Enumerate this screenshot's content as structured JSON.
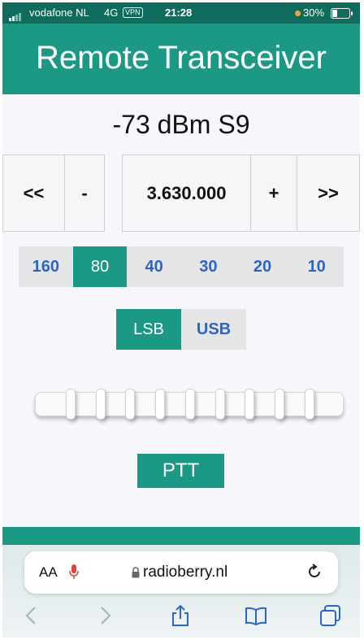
{
  "status_bar": {
    "carrier": "vodafone NL",
    "network": "4G",
    "vpn": "VPN",
    "time": "21:28",
    "battery": "30%"
  },
  "header": {
    "title": "Remote Transceiver"
  },
  "signal": {
    "reading": "-73 dBm S9"
  },
  "tuning": {
    "fast_down": "<<",
    "step_down": "-",
    "frequency": "3.630.000",
    "step_up": "+",
    "fast_up": ">>"
  },
  "bands": [
    {
      "label": "160",
      "active": false
    },
    {
      "label": "80",
      "active": true
    },
    {
      "label": "40",
      "active": false
    },
    {
      "label": "30",
      "active": false
    },
    {
      "label": "20",
      "active": false
    },
    {
      "label": "10",
      "active": false
    }
  ],
  "mode": {
    "lsb": "LSB",
    "usb": "USB",
    "selected": "LSB"
  },
  "ptt": {
    "label": "PTT"
  },
  "browser": {
    "aa_label": "AA",
    "url": "radioberry.nl"
  },
  "colors": {
    "accent": "#1c9984",
    "link": "#2b66c6"
  },
  "icons": [
    "signal-bars-icon",
    "battery-icon",
    "microphone-icon",
    "lock-icon",
    "reload-icon",
    "back-icon",
    "forward-icon",
    "share-icon",
    "bookmarks-icon",
    "tabs-icon"
  ]
}
